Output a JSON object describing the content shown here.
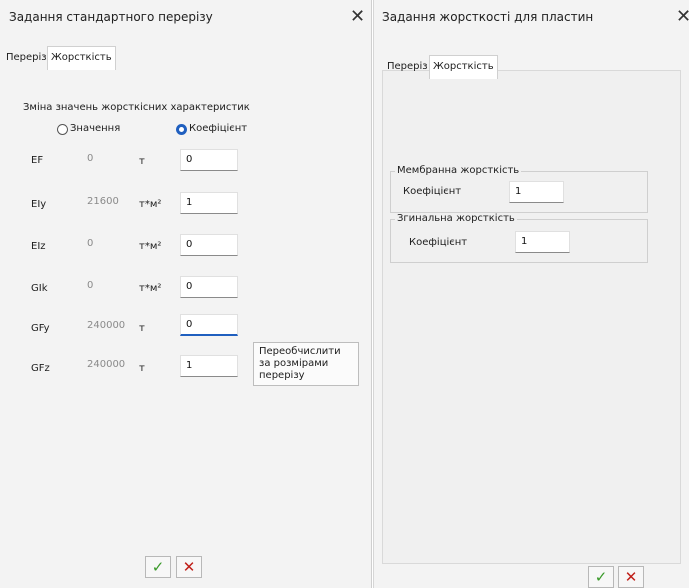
{
  "left_dialog": {
    "title": "Задання стандартного перерізу",
    "close_glyph": "✕",
    "tabs": [
      {
        "label": "Переріз",
        "active": false
      },
      {
        "label": "Жорсткість",
        "active": true
      }
    ],
    "section_label": "Зміна значень жорсткісних характеристик",
    "radio_values_label": "Значення",
    "radio_coef_label": "Коефіцієнт",
    "radio_selected": "Коефіцієнт",
    "rows": [
      {
        "name": "EF",
        "value": "0",
        "unit": "т",
        "coef": "0"
      },
      {
        "name": "EIy",
        "value": "21600",
        "unit": "т*м²",
        "coef": "1"
      },
      {
        "name": "EIz",
        "value": "0",
        "unit": "т*м²",
        "coef": "0"
      },
      {
        "name": "GIk",
        "value": "0",
        "unit": "т*м²",
        "coef": "0"
      },
      {
        "name": "GFy",
        "value": "240000",
        "unit": "т",
        "coef": "0"
      },
      {
        "name": "GFz",
        "value": "240000",
        "unit": "т",
        "coef": "1"
      }
    ],
    "recalc_button": "Переобчислити за розмірами перерізу",
    "ok_glyph": "✓",
    "cancel_glyph": "✕"
  },
  "right_dialog": {
    "title": "Задання жорсткості для пластин",
    "close_glyph": "✕",
    "tabs": [
      {
        "label": "Переріз",
        "active": false
      },
      {
        "label": "Жорсткість",
        "active": true
      }
    ],
    "groups": [
      {
        "title": "Мембранна жорсткість",
        "label": "Коефіцієнт",
        "value": "1"
      },
      {
        "title": "Згинальна жорсткість",
        "label": "Коефіцієнт",
        "value": "1"
      }
    ],
    "ok_glyph": "✓",
    "cancel_glyph": "✕"
  },
  "colors": {
    "accent": "#1f5fbf",
    "ok_green": "#3a9a2a",
    "cancel_red": "#c0201a"
  }
}
